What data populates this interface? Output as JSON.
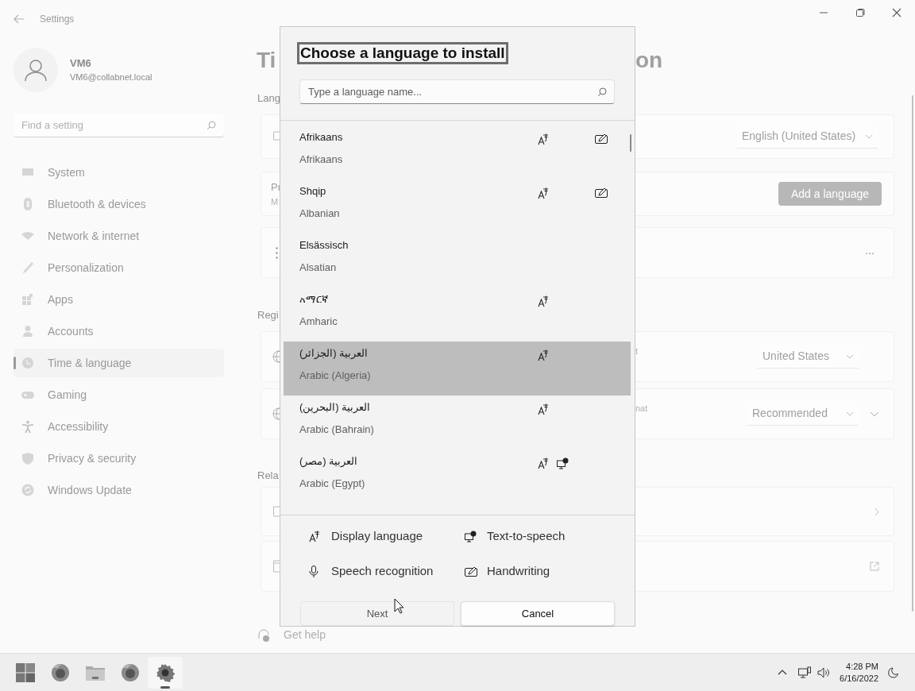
{
  "window": {
    "title": "Settings"
  },
  "account": {
    "name": "VM6",
    "email": "VM6@collabnet.local"
  },
  "search": {
    "placeholder": "Find a setting"
  },
  "nav": [
    {
      "label": "System",
      "selected": false
    },
    {
      "label": "Bluetooth & devices",
      "selected": false
    },
    {
      "label": "Network & internet",
      "selected": false
    },
    {
      "label": "Personalization",
      "selected": false
    },
    {
      "label": "Apps",
      "selected": false
    },
    {
      "label": "Accounts",
      "selected": false
    },
    {
      "label": "Time & language",
      "selected": true
    },
    {
      "label": "Gaming",
      "selected": false
    },
    {
      "label": "Accessibility",
      "selected": false
    },
    {
      "label": "Privacy & security",
      "selected": false
    },
    {
      "label": "Windows Update",
      "selected": false
    }
  ],
  "page": {
    "heading_fragments": [
      "Ti",
      "on"
    ],
    "language_label": "Lang",
    "language_dropdown": "English (United States)",
    "preferred_fragments": [
      "Pr",
      "M"
    ],
    "add_button": "Add a language",
    "more_button": "...",
    "region_label": "Regi",
    "region_fragment": "t",
    "region_dropdown": "United States",
    "format_fragment": "nat",
    "format_dropdown": "Recommended",
    "related_label": "Rela",
    "help_link": "Get help"
  },
  "dialog": {
    "title": "Choose a language to install",
    "search_placeholder": "Type a language name...",
    "languages": [
      {
        "native": "Afrikaans",
        "english": "Afrikaans",
        "display": true,
        "tts": false,
        "handwriting": true,
        "selected": false
      },
      {
        "native": "Shqip",
        "english": "Albanian",
        "display": true,
        "tts": false,
        "handwriting": true,
        "selected": false
      },
      {
        "native": "Elsässisch",
        "english": "Alsatian",
        "display": false,
        "tts": false,
        "handwriting": false,
        "selected": false
      },
      {
        "native": "አማርኛ",
        "english": "Amharic",
        "display": true,
        "tts": false,
        "handwriting": false,
        "selected": false
      },
      {
        "native": "العربية (الجزائر)",
        "english": "Arabic (Algeria)",
        "display": true,
        "tts": false,
        "handwriting": false,
        "selected": true
      },
      {
        "native": "العربية (البحرين)",
        "english": "Arabic (Bahrain)",
        "display": true,
        "tts": false,
        "handwriting": false,
        "selected": false
      },
      {
        "native": "العربية (مصر)",
        "english": "Arabic (Egypt)",
        "display": true,
        "tts": true,
        "handwriting": false,
        "selected": false
      }
    ],
    "legend": [
      {
        "kind": "display",
        "label": "Display language"
      },
      {
        "kind": "tts",
        "label": "Text-to-speech"
      },
      {
        "kind": "speech",
        "label": "Speech recognition"
      },
      {
        "kind": "handwriting",
        "label": "Handwriting"
      }
    ],
    "buttons": [
      {
        "label": "Next",
        "disabled": true
      },
      {
        "label": "Cancel",
        "disabled": false
      }
    ]
  },
  "taskbar": {
    "apps": [
      {
        "kind": "start",
        "active": false
      },
      {
        "kind": "browser",
        "active": false
      },
      {
        "kind": "folder",
        "active": false
      },
      {
        "kind": "browser",
        "active": false
      },
      {
        "kind": "settings",
        "active": true
      }
    ],
    "time": "4:28 PM",
    "date": "6/16/2022"
  }
}
